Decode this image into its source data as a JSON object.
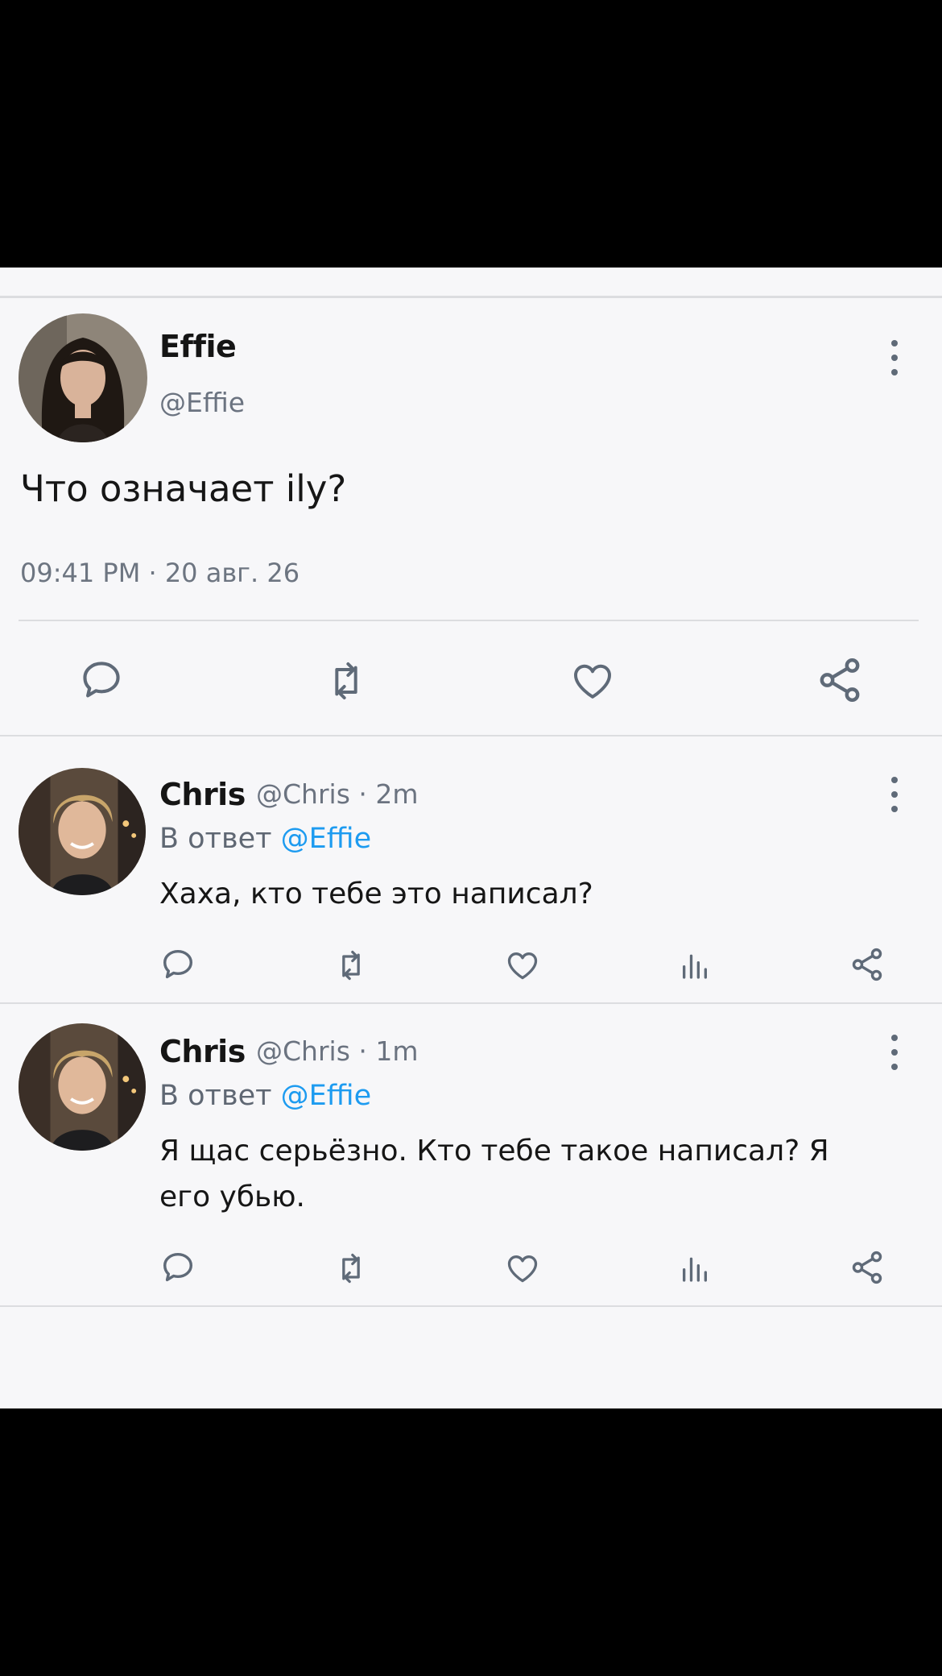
{
  "main_tweet": {
    "author_name": "Effie",
    "author_handle": "@Effie",
    "text": "Что означает ily?",
    "timestamp": "09:41 PM · 20 авг. 26"
  },
  "replies": [
    {
      "author_name": "Chris",
      "meta": "@Chris · 2m",
      "reply_prefix": "В ответ",
      "reply_to": "@Effie",
      "text": "Хаха, кто тебе это написал?"
    },
    {
      "author_name": "Chris",
      "meta": "@Chris · 1m",
      "reply_prefix": "В ответ",
      "reply_to": "@Effie",
      "text": "Я щас серьёзно. Кто тебе такое написал? Я его убью."
    }
  ],
  "icons": {
    "main_actions": [
      "comment-icon",
      "retweet-icon",
      "heart-icon",
      "share-icon"
    ],
    "reply_actions": [
      "comment-icon",
      "retweet-icon",
      "heart-icon",
      "views-icon",
      "share-icon"
    ],
    "menu": "more-vertical-icon"
  },
  "colors": {
    "background": "#f7f7f9",
    "text": "#161616",
    "secondary_text": "#6b7380",
    "mention": "#1d9bf0",
    "icon": "#5f6a78",
    "divider": "#dcdde0"
  }
}
